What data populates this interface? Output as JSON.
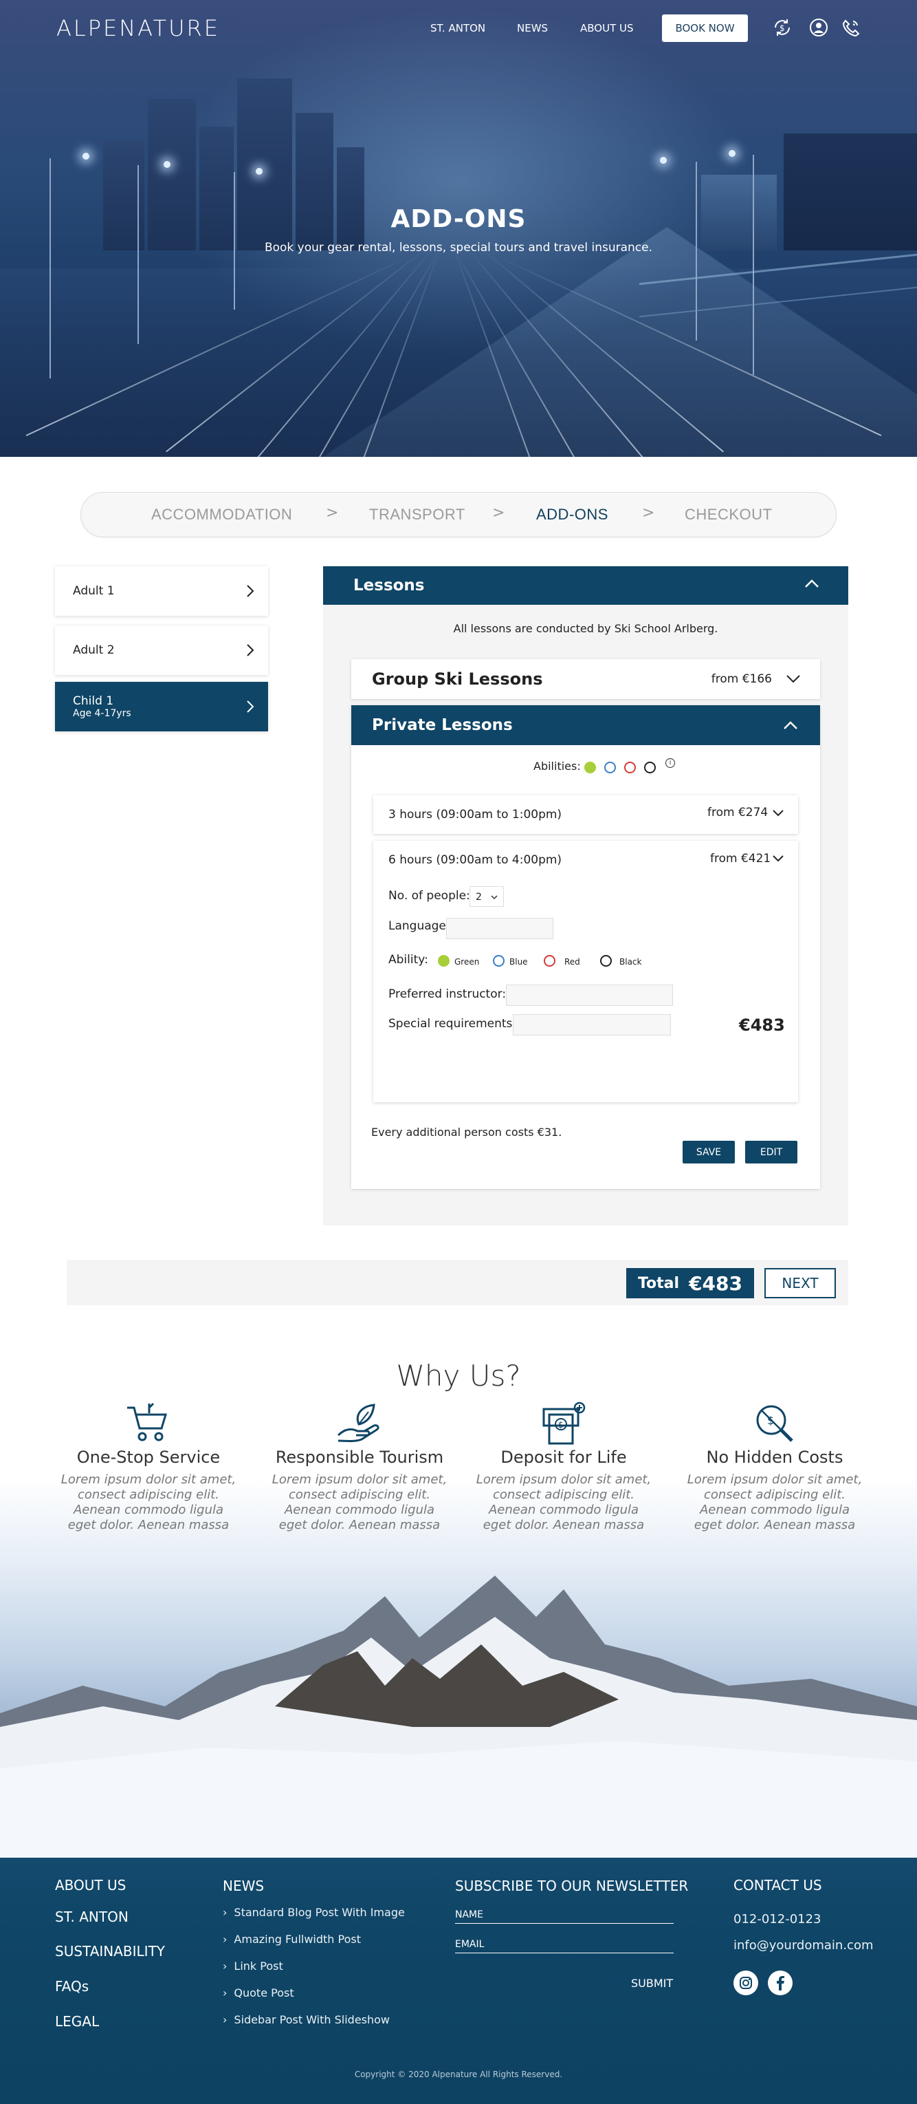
{
  "header": {
    "logo": "ALPENATURE",
    "nav": [
      "ST. ANTON",
      "NEWS",
      "ABOUT US"
    ],
    "book_now": "BOOK NOW",
    "icons": [
      "currency-exchange-icon",
      "user-icon",
      "phone-icon"
    ]
  },
  "hero": {
    "title": "ADD-ONS",
    "subtitle": "Book your gear rental, lessons, special tours and travel insurance."
  },
  "steps": {
    "items": [
      "ACCOMMODATION",
      "TRANSPORT",
      "ADD-ONS",
      "CHECKOUT"
    ],
    "separator": ">",
    "active": "ADD-ONS"
  },
  "travellers": [
    {
      "name": "Adult 1",
      "age": ""
    },
    {
      "name": "Adult 2",
      "age": ""
    },
    {
      "name": "Child 1",
      "age": "Age 4-17yrs",
      "active": true
    }
  ],
  "lessons": {
    "title": "Lessons",
    "note": "All lessons are conducted by Ski School Arlberg.",
    "group": {
      "title": "Group Ski Lessons",
      "price": "from €166"
    },
    "private": {
      "title": "Private Lessons",
      "abilities_label": "Abilities:",
      "options": [
        {
          "title": "3 hours (09:00am to 1:00pm)",
          "price": "from €274"
        },
        {
          "title": "6 hours (09:00am to 4:00pm)",
          "price": "from €421"
        }
      ],
      "form": {
        "people_label": "No. of people:",
        "people_value": "2",
        "language_label": "Language:",
        "language_value": "",
        "ability_label": "Ability:",
        "abilities": [
          {
            "name": "Green",
            "color": "#a6cf3a",
            "selected": true
          },
          {
            "name": "Blue",
            "color": "#3a7fc4",
            "selected": false
          },
          {
            "name": "Red",
            "color": "#d43a3a",
            "selected": false
          },
          {
            "name": "Black",
            "color": "#222222",
            "selected": false
          }
        ],
        "instructor_label": "Preferred instructor:",
        "instructor_value": "",
        "requirements_label": "Special requirements:",
        "requirements_value": "",
        "subtotal": "€483"
      },
      "additional_note": "Every additional person costs €31.",
      "save": "SAVE",
      "edit": "EDIT"
    }
  },
  "summary": {
    "total_label": "Total",
    "total_value": "€483",
    "next": "NEXT"
  },
  "why_us": {
    "title": "Why Us?",
    "features": [
      {
        "icon": "cart-icon",
        "title": "One-Stop Service",
        "text": "Lorem ipsum dolor sit amet, consect adipiscing elit. Aenean commodo ligula eget dolor. Aenean massa"
      },
      {
        "icon": "leaf-hand-icon",
        "title": "Responsible Tourism",
        "text": "Lorem ipsum dolor sit amet, consect adipiscing elit. Aenean commodo ligula eget dolor. Aenean massa"
      },
      {
        "icon": "deposit-icon",
        "title": "Deposit for Life",
        "text": "Lorem ipsum dolor sit amet, consect adipiscing elit. Aenean commodo ligula eget dolor. Aenean massa"
      },
      {
        "icon": "no-hidden-cost-icon",
        "title": "No Hidden Costs",
        "text": "Lorem ipsum dolor sit amet, consect adipiscing elit. Aenean commodo ligula eget dolor. Aenean massa"
      }
    ]
  },
  "footer": {
    "links": [
      "ABOUT US",
      "ST. ANTON",
      "SUSTAINABILITY",
      "FAQs",
      "LEGAL"
    ],
    "news_title": "NEWS",
    "news": [
      "Standard Blog Post With Image",
      "Amazing Fullwidth Post",
      "Link Post",
      "Quote Post",
      "Sidebar Post With Slideshow"
    ],
    "newsletter_title": "SUBSCRIBE TO OUR NEWSLETTER",
    "name_placeholder": "NAME",
    "email_placeholder": "EMAIL",
    "submit": "SUBMIT",
    "contact_title": "CONTACT US",
    "phone": "012-012-0123",
    "email": "info@yourdomain.com",
    "social": [
      "instagram-icon",
      "facebook-icon"
    ],
    "copyright": "Copyright © 2020  Alpenature  All Rights Reserved."
  }
}
